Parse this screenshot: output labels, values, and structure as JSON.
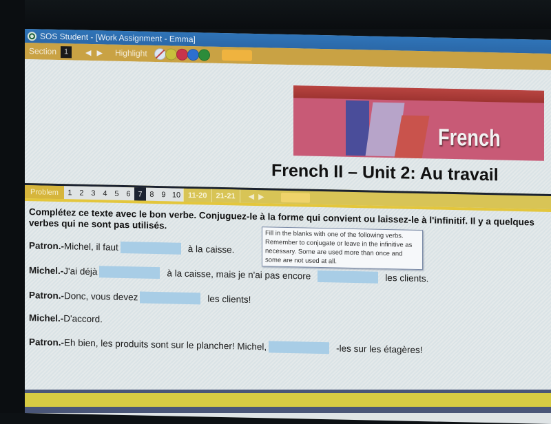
{
  "window": {
    "title": "SOS Student - [Work Assignment - Emma]"
  },
  "toolbar": {
    "section_label": "Section",
    "section_value": "1",
    "highlight_label": "Highlight",
    "highlight_colors": [
      {
        "name": "none",
        "color": "#dbe6f4"
      },
      {
        "name": "yellow",
        "color": "#c8c03c"
      },
      {
        "name": "red",
        "color": "#c8344a"
      },
      {
        "name": "blue",
        "color": "#2d6fd0"
      },
      {
        "name": "green",
        "color": "#2d8c3a"
      }
    ]
  },
  "banner": {
    "word": "French"
  },
  "unit_title": "French II – Unit 2: Au travail",
  "problem_bar": {
    "label": "Problem",
    "numbers": [
      "1",
      "2",
      "3",
      "4",
      "5",
      "6",
      "7",
      "8",
      "9",
      "10"
    ],
    "active": "7",
    "ranges": [
      "11-20",
      "21-21"
    ]
  },
  "instructions": "Complétez ce texte avec le bon verbe. Conjuguez-le à la forme qui convient ou laissez-le à l'infinitif. Il y a quelques verbes qui ne sont pas utilisés.",
  "tooltip": "Fill in the blanks with one of the following verbs. Remember to conjugate or leave in the infinitive as necessary. Some are used more than once and some are not used at all.",
  "dialogue": [
    {
      "speaker": "Patron.-",
      "before": "Michel, il faut",
      "after": "à la caisse."
    },
    {
      "speaker": "Michel.-",
      "before": "J'ai déjà",
      "middle": "à la caisse, mais je n'ai pas encore",
      "after": "les clients."
    },
    {
      "speaker": "Patron.-",
      "before": "Donc, vous devez",
      "after": "les clients!"
    },
    {
      "speaker": "Michel.-",
      "before": "D'accord."
    },
    {
      "speaker": "Patron.-",
      "before": "Eh bien, les produits sont sur le plancher! Michel,",
      "after": "-les sur les étagères!"
    }
  ],
  "blanks": [
    "",
    "",
    "",
    "",
    ""
  ]
}
